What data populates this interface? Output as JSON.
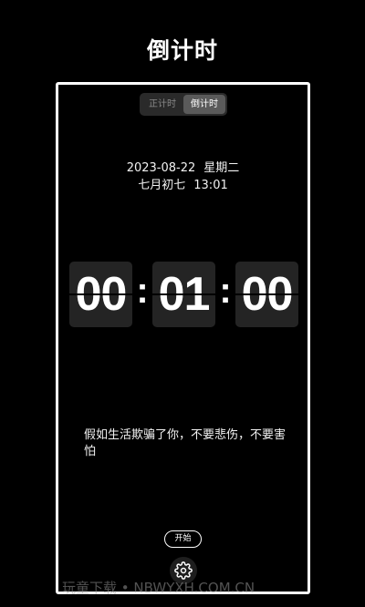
{
  "header": {
    "title": "倒计时"
  },
  "mode_toggle": {
    "tabs": [
      "正计时",
      "倒计时"
    ],
    "active_index": 1
  },
  "datetime": {
    "date": "2023-08-22",
    "weekday": "星期二",
    "lunar_date": "七月初七",
    "time": "13:01"
  },
  "countdown": {
    "hours": "00",
    "minutes": "01",
    "seconds": "00",
    "separator": ":"
  },
  "quote": "假如生活欺骗了你，不要悲伤，不要害怕",
  "controls": {
    "start_label": "开始",
    "settings_icon": "gear-icon"
  },
  "watermark": "玩童下载 • NBWYXH.COM.CN"
}
